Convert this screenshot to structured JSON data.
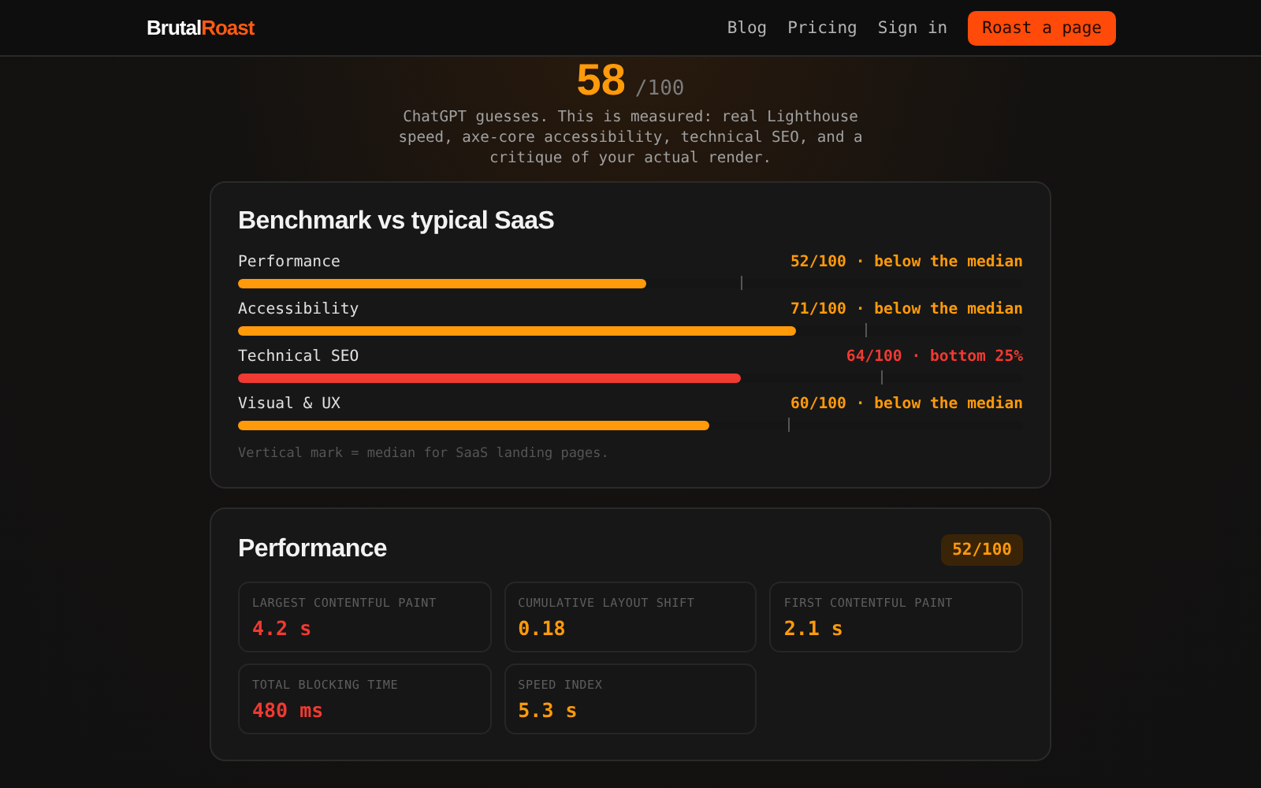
{
  "nav": {
    "logo_first": "Brutal",
    "logo_second": "Roast",
    "links": [
      "Blog",
      "Pricing",
      "Sign in"
    ],
    "cta": "Roast a page"
  },
  "hero": {
    "score": "58",
    "out_of": "/100",
    "text": "ChatGPT guesses. This is measured: real Lighthouse speed, axe-core accessibility, technical SEO, and a critique of your actual render."
  },
  "benchmark": {
    "title": "Benchmark vs typical SaaS",
    "rows": [
      {
        "label": "Performance",
        "reading": "52/100 · below the median",
        "color": "#ff9a0a",
        "level": 0.52,
        "median": {
          "level": 0.64
        }
      },
      {
        "label": "Accessibility",
        "reading": "71/100 · below the median",
        "color": "#ff9a0a",
        "level": 0.71,
        "median": {
          "level": 0.8
        }
      },
      {
        "label": "Technical SEO",
        "reading": "64/100 · bottom 25%",
        "color": "#f03a32",
        "level": 0.64,
        "median": {
          "level": 0.82
        }
      },
      {
        "label": "Visual & UX",
        "reading": "60/100 · below the median",
        "color": "#ff9a0a",
        "level": 0.6,
        "median": {
          "level": 0.7
        }
      }
    ],
    "note": "Vertical mark = median for SaaS landing pages."
  },
  "performance": {
    "title": "Performance",
    "score": "52/100",
    "metrics": [
      {
        "label": "LARGEST CONTENTFUL PAINT",
        "value": "4.2 s",
        "color": "#f03a32"
      },
      {
        "label": "CUMULATIVE LAYOUT SHIFT",
        "value": "0.18",
        "color": "#ff9a0a"
      },
      {
        "label": "FIRST CONTENTFUL PAINT",
        "value": "2.1 s",
        "color": "#ff9a0a"
      },
      {
        "label": "TOTAL BLOCKING TIME",
        "value": "480 ms",
        "color": "#f03a32"
      },
      {
        "label": "SPEED INDEX",
        "value": "5.3 s",
        "color": "#ff9a0a"
      }
    ]
  }
}
